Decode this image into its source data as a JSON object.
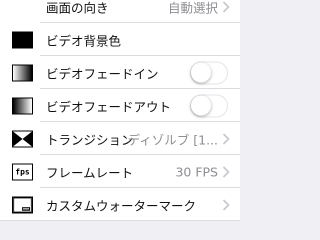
{
  "rows": [
    {
      "label": "画面の向き",
      "value": "自動選択"
    },
    {
      "label": "ビデオ背景色"
    },
    {
      "label": "ビデオフェードイン",
      "toggle": false
    },
    {
      "label": "ビデオフェードアウト",
      "toggle": false
    },
    {
      "label": "トランジション",
      "value": "ディゾルブ [1..."
    },
    {
      "label": "フレームレート",
      "value": "30 FPS",
      "icon_text": "fps"
    },
    {
      "label": "カスタムウォーターマーク"
    }
  ],
  "icons": {
    "orientation": "screen-orientation-icon",
    "background": "black-square-icon",
    "fade_in": "gradient-fade-in-icon",
    "fade_out": "gradient-fade-out-icon",
    "transition": "bowtie-transition-icon",
    "frame_rate": "fps-icon",
    "watermark": "watermark-icon",
    "chevron": "chevron-right-icon"
  },
  "colors": {
    "background": "#efeff4",
    "cell": "#ffffff",
    "value_text": "#8e8e93",
    "separator": "#dcdce0"
  }
}
